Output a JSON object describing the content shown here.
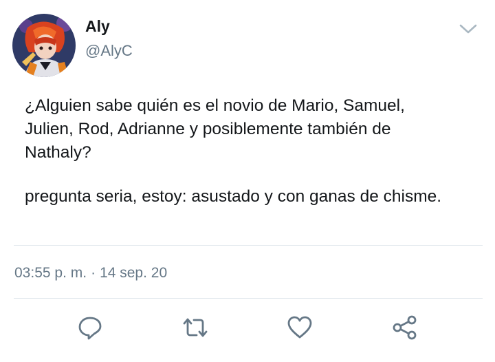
{
  "user": {
    "display_name": "Aly",
    "handle": "@AlyC"
  },
  "tweet": {
    "paragraph1": "¿Alguien sabe quién es el novio de Mario, Samuel,\nJulien, Rod,  Adrianne y posiblemente también de\nNathaly?",
    "paragraph2": "pregunta seria, estoy: asustado y con ganas de chisme."
  },
  "meta": {
    "time": "03:55 p. m.",
    "separator": "·",
    "date": "14 sep. 20"
  },
  "icons": {
    "menu": "chevron-down-icon",
    "reply": "reply-icon",
    "retweet": "retweet-icon",
    "like": "heart-icon",
    "share": "share-icon"
  },
  "colors": {
    "text": "#14171a",
    "secondary": "#657786",
    "divider": "#e1e8ed",
    "icon": "#657786"
  }
}
